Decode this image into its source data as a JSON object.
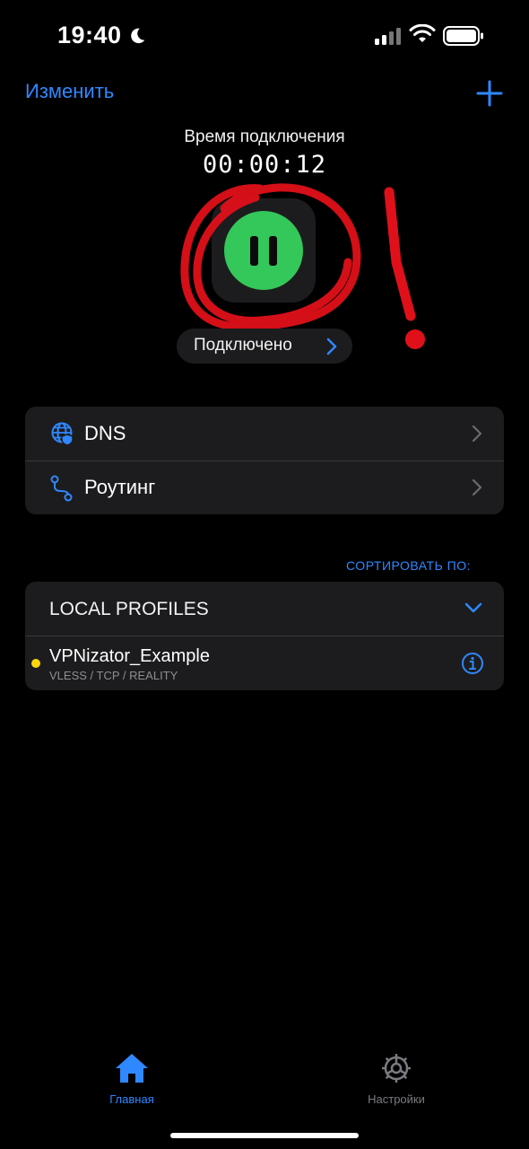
{
  "status_bar": {
    "time": "19:40",
    "moon_icon": "moon-icon",
    "signal_icon": "cellular-signal-icon",
    "wifi_icon": "wifi-icon",
    "battery_icon": "battery-icon"
  },
  "header": {
    "edit_label": "Изменить",
    "add_icon": "plus-icon"
  },
  "connection": {
    "label": "Время подключения",
    "timer": "00:00:12",
    "button_icon": "pause-icon",
    "status": "Подключено"
  },
  "settings_card": {
    "items": [
      {
        "label": "DNS",
        "icon": "globe-shield-icon"
      },
      {
        "label": "Роутинг",
        "icon": "routing-icon"
      }
    ]
  },
  "sort_label": "СОРТИРОВАТЬ ПО:",
  "profiles": {
    "group_title": "LOCAL PROFILES",
    "items": [
      {
        "name": "VPNizator_Example",
        "details": "VLESS / TCP / REALITY",
        "status_color": "#ffd60a"
      }
    ]
  },
  "tab_bar": {
    "tabs": [
      {
        "label": "Главная",
        "icon": "house-icon",
        "active": true
      },
      {
        "label": "Настройки",
        "icon": "gear-icon",
        "active": false
      }
    ]
  },
  "colors": {
    "accent": "#2f88ff",
    "connected_green": "#34c759",
    "annotation_red": "#e0101a",
    "card_bg": "#1c1c1e"
  }
}
